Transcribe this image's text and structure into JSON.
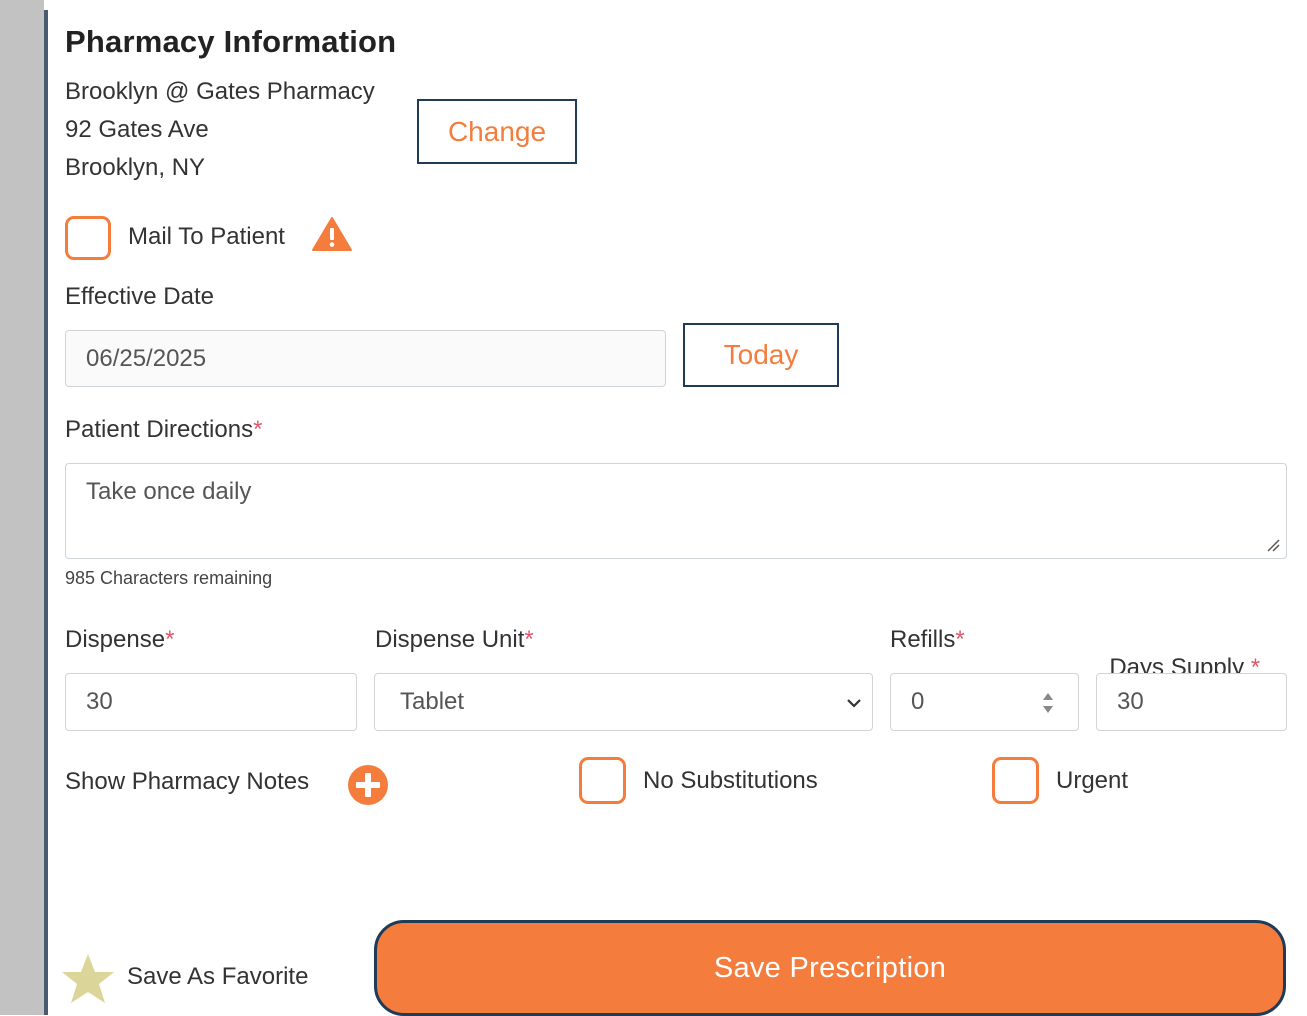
{
  "pharmacy": {
    "title": "Pharmacy Information",
    "name": "Brooklyn @ Gates Pharmacy",
    "street": "92 Gates Ave",
    "city": "Brooklyn, NY",
    "change_label": "Change"
  },
  "mail_to_patient": {
    "label": "Mail To Patient",
    "checked": false,
    "icon": "warning-icon"
  },
  "effective_date": {
    "label": "Effective Date",
    "value": "06/25/2025",
    "today_label": "Today"
  },
  "directions": {
    "label": "Patient Directions",
    "required_mark": "*",
    "value": "Take once daily",
    "counter": "985 Characters remaining"
  },
  "dispense": {
    "label": "Dispense",
    "required_mark": "*",
    "value": "30"
  },
  "dispense_unit": {
    "label": "Dispense Unit",
    "required_mark": "*",
    "selected": "Tablet"
  },
  "refills": {
    "label": "Refills",
    "required_mark": "*",
    "value": "0"
  },
  "days_supply": {
    "label": "Days Supply ",
    "required_mark": "*",
    "value": "30"
  },
  "options": {
    "show_notes_label": "Show Pharmacy Notes",
    "no_substitutions_label": "No Substitutions",
    "urgent_label": "Urgent"
  },
  "footer": {
    "favorite_label": "Save As Favorite",
    "save_label": "Save Prescription"
  },
  "colors": {
    "accent": "#f47c3c",
    "border_dark": "#1f3b57",
    "required": "#e0566a",
    "star": "#dcd59a"
  }
}
